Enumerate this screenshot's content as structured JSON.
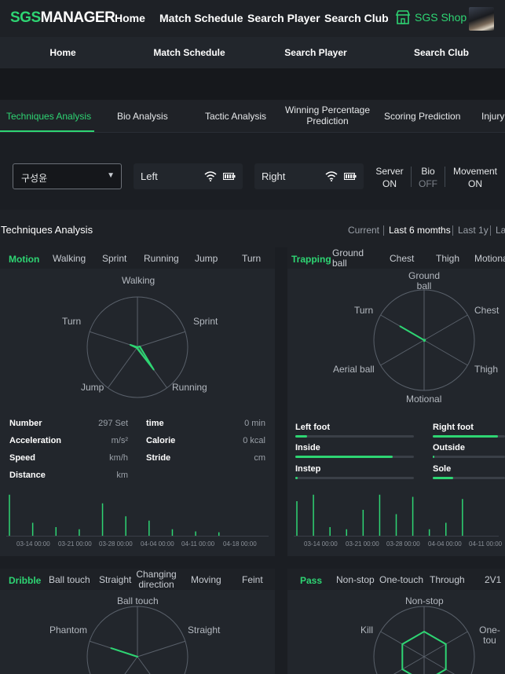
{
  "brand": {
    "part1": "SGS",
    "part2": "MANAGER"
  },
  "topnav": [
    "Home",
    "Match Schedule",
    "Search Player",
    "Search Club"
  ],
  "shop": {
    "label": "SGS Shop",
    "icon": "shop-icon"
  },
  "subnav": [
    "Home",
    "Match Schedule",
    "Search Player",
    "Search Club"
  ],
  "tabs": [
    {
      "label": "Techniques Analysis",
      "active": true
    },
    {
      "label": "Bio Analysis"
    },
    {
      "label": "Tactic Analysis"
    },
    {
      "label": "Winning Percentage Prediction"
    },
    {
      "label": "Scoring Prediction"
    },
    {
      "label": "Injury"
    }
  ],
  "player_select": {
    "value": "구성윤"
  },
  "devices": [
    {
      "label": "Left",
      "icons": [
        "wifi-icon",
        "battery-icon"
      ]
    },
    {
      "label": "Right",
      "icons": [
        "wifi-icon",
        "battery-icon"
      ]
    }
  ],
  "status": [
    {
      "name": "Server",
      "value": "ON"
    },
    {
      "name": "Bio",
      "value": "OFF"
    },
    {
      "name": "Movement",
      "value": "ON"
    }
  ],
  "section": {
    "title": "Techniques Analysis",
    "periods": [
      "Current",
      "Last 6 momths",
      "Last 1y",
      "La"
    ],
    "selected_period": "Last 6 momths"
  },
  "motion": {
    "title": "Motion",
    "header_items": [
      "Walking",
      "Sprint",
      "Running",
      "Jump",
      "Turn"
    ],
    "radar_axes": [
      "Walking",
      "Sprint",
      "Running",
      "Jump",
      "Turn"
    ],
    "radar_values": [
      0.0,
      0.05,
      0.55,
      0.02,
      0.15
    ],
    "stats_left": [
      {
        "label": "Number",
        "value": "297 Set"
      },
      {
        "label": "Acceleration",
        "value": "m/s²"
      },
      {
        "label": "Speed",
        "value": "km/h"
      },
      {
        "label": "Distance",
        "value": "km"
      }
    ],
    "stats_right": [
      {
        "label": "time",
        "value": "0 min"
      },
      {
        "label": "Calorie",
        "value": "0 kcal"
      },
      {
        "label": "Stride",
        "value": "cm"
      }
    ],
    "x_ticks": [
      "03-14 00:00",
      "03-21 00:00",
      "03-28 00:00",
      "04-04 00:00",
      "04-11 00:00",
      "04-18 00:00"
    ],
    "spikes": [
      0.95,
      0.3,
      0.2,
      0.15,
      0.75,
      0.45,
      0.35,
      0.15,
      0.1,
      0.08
    ]
  },
  "trapping": {
    "title": "Trapping",
    "header_items": [
      "Ground ball",
      "Chest",
      "Thigh",
      "Motional"
    ],
    "radar_axes": [
      "Ground ball",
      "Chest",
      "Thigh",
      "Motional",
      "Aerial ball",
      "Turn"
    ],
    "radar_values": [
      0.0,
      0.02,
      0.02,
      0.02,
      0.0,
      0.55
    ],
    "bars_left": [
      {
        "label": "Left foot",
        "value": 0.1
      },
      {
        "label": "Inside",
        "value": 0.82
      },
      {
        "label": "Instep",
        "value": 0.02
      }
    ],
    "bars_right": [
      {
        "label": "Right foot",
        "value": 0.9
      },
      {
        "label": "Outside",
        "value": 0.0
      },
      {
        "label": "Sole",
        "value": 0.28
      }
    ],
    "x_ticks": [
      "03-14 00:00",
      "03-21 00:00",
      "03-28 00:00",
      "04-04 00:00",
      "04-11 00:00"
    ],
    "spikes": [
      0.8,
      0.95,
      0.2,
      0.15,
      0.6,
      0.95,
      0.5,
      0.9,
      0.15,
      0.3,
      0.85
    ]
  },
  "dribble": {
    "title": "Dribble",
    "header_items": [
      "Ball touch",
      "Straight",
      "Changing direction",
      "Moving",
      "Feint"
    ],
    "radar_axes": [
      "Ball touch",
      "Straight",
      "Phantom"
    ],
    "radar_values": [
      0.0,
      0.0,
      0.55
    ]
  },
  "pass": {
    "title": "Pass",
    "header_items": [
      "Non-stop",
      "One-touch",
      "Through",
      "2V1"
    ],
    "radar_axes": [
      "Non-stop",
      "One-tou",
      "Kill"
    ],
    "radar_values": [
      0.5,
      0.5,
      0.5
    ]
  },
  "colors": {
    "accent": "#2ed573",
    "bg": "#1b1e23",
    "panel": "#22262c"
  }
}
